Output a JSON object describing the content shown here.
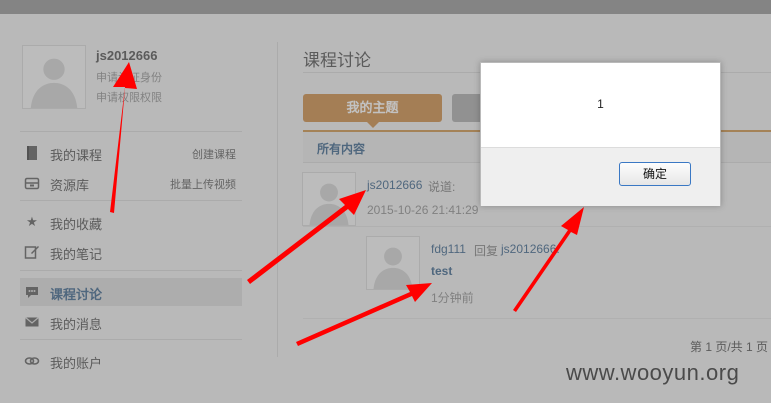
{
  "sidebar": {
    "username": "js2012666",
    "line1": "申请认证身份",
    "line2": "申请权限权限",
    "items": [
      {
        "label": "我的课程",
        "action": "创建课程",
        "icon": "book-icon"
      },
      {
        "label": "资源库",
        "action": "批量上传视频",
        "icon": "drive-icon"
      },
      {
        "label": "我的收藏",
        "icon": "star-icon"
      },
      {
        "label": "我的笔记",
        "icon": "edit-icon"
      },
      {
        "label": "课程讨论",
        "icon": "chat-icon"
      },
      {
        "label": "我的消息",
        "icon": "mail-icon"
      },
      {
        "label": "我的账户",
        "icon": "link-icon"
      }
    ]
  },
  "main": {
    "title": "课程讨论",
    "tab_mine": "我的主题",
    "filter": "所有内容",
    "post": {
      "user": "js2012666",
      "verb": "说道:",
      "time": "2015-10-26 21:41:29"
    },
    "reply": {
      "user": "fdg111",
      "verb": "回复",
      "target": "js2012666:",
      "text": "test",
      "time": "1分钟前"
    },
    "pagination": "第 1 页/共 1 页"
  },
  "dialog": {
    "message": "1",
    "ok_label": "确定"
  },
  "watermark": "www.wooyun.org",
  "colors": {
    "accent_orange": "#c9843a",
    "link_blue": "#2f5a84",
    "arrow_red": "#ff0000"
  }
}
